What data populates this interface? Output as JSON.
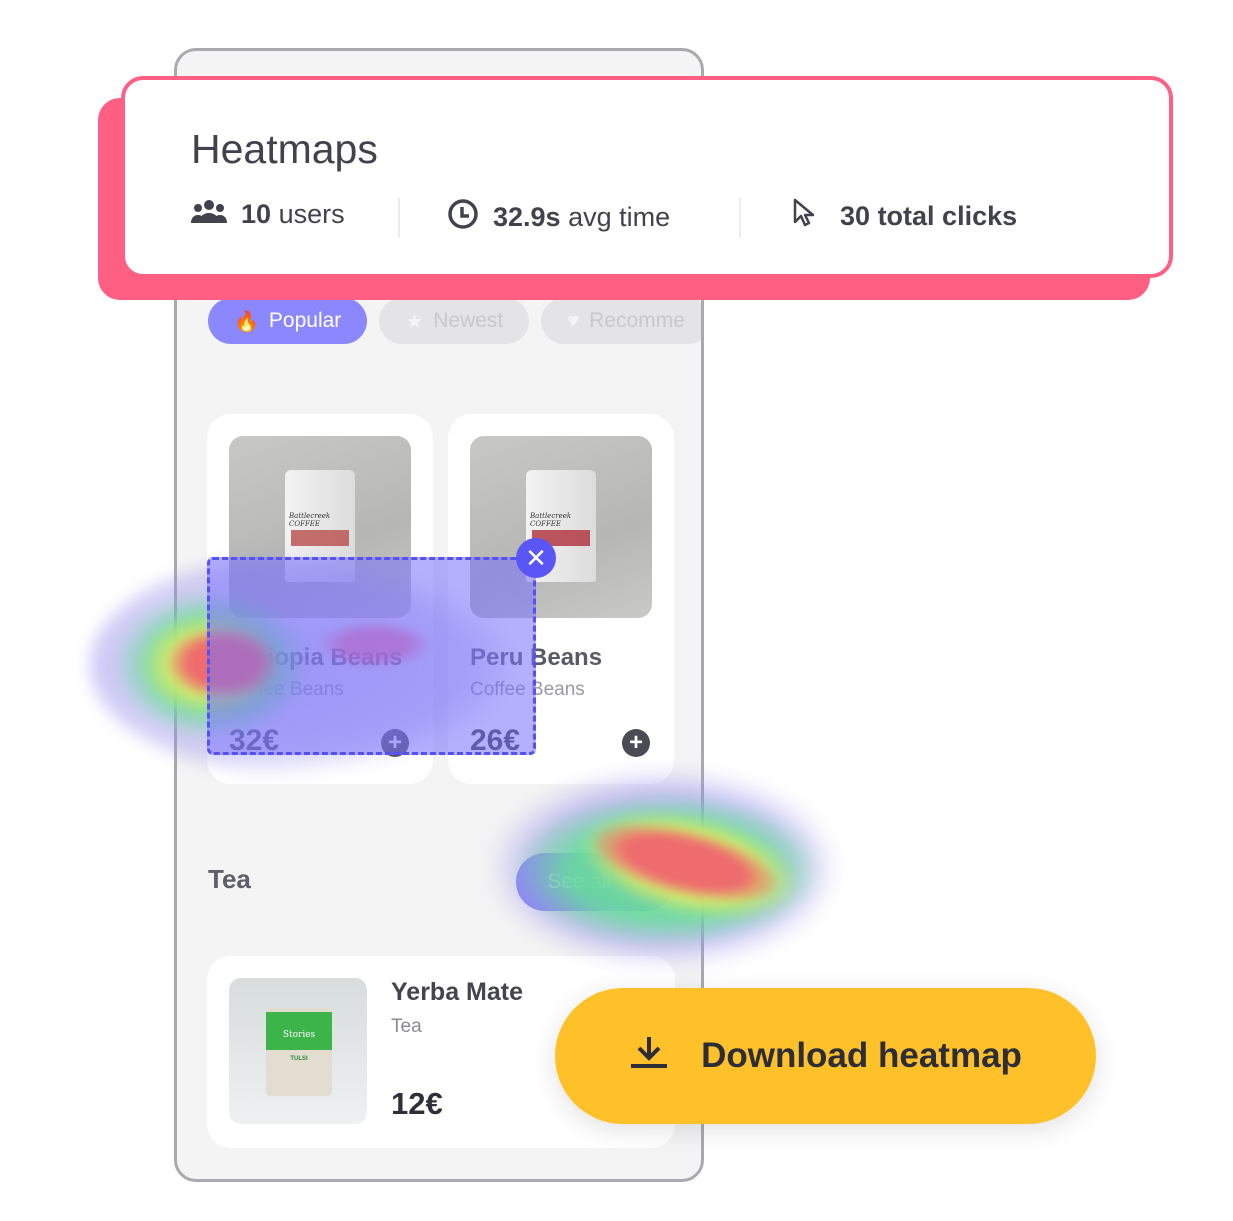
{
  "stats_card": {
    "title": "Heatmaps",
    "items": [
      {
        "icon": "users-icon",
        "value": "10",
        "label": "users"
      },
      {
        "icon": "clock-icon",
        "value": "32.9s",
        "label": "avg time"
      },
      {
        "icon": "cursor-icon",
        "value": "30",
        "label": "total clicks"
      }
    ],
    "accent": "#ff5f82"
  },
  "filters": [
    {
      "icon": "flame-icon",
      "glyph": "🔥",
      "label": "Popular",
      "active": true
    },
    {
      "icon": "star-icon",
      "glyph": "★",
      "label": "Newest",
      "active": false
    },
    {
      "icon": "heart-icon",
      "glyph": "♥",
      "label": "Recomme",
      "active": false
    }
  ],
  "products": [
    {
      "name": "Ethiopia Beans",
      "category": "Coffee Beans",
      "price": "32€",
      "brand": "Battlecreek COFFEE"
    },
    {
      "name": "Peru Beans",
      "category": "Coffee Beans",
      "price": "26€",
      "brand": "Battlecreek COFFEE"
    }
  ],
  "tea_section": {
    "title": "Tea",
    "see_all": "See all",
    "arrow": "→",
    "item": {
      "name": "Yerba Mate",
      "category": "Tea",
      "price": "12€",
      "brand": "Stories",
      "sub": "TULSI"
    }
  },
  "selection": {
    "close": "✕"
  },
  "plus": "+",
  "download_button": {
    "label": "Download heatmap",
    "accent": "#ffc12a"
  }
}
